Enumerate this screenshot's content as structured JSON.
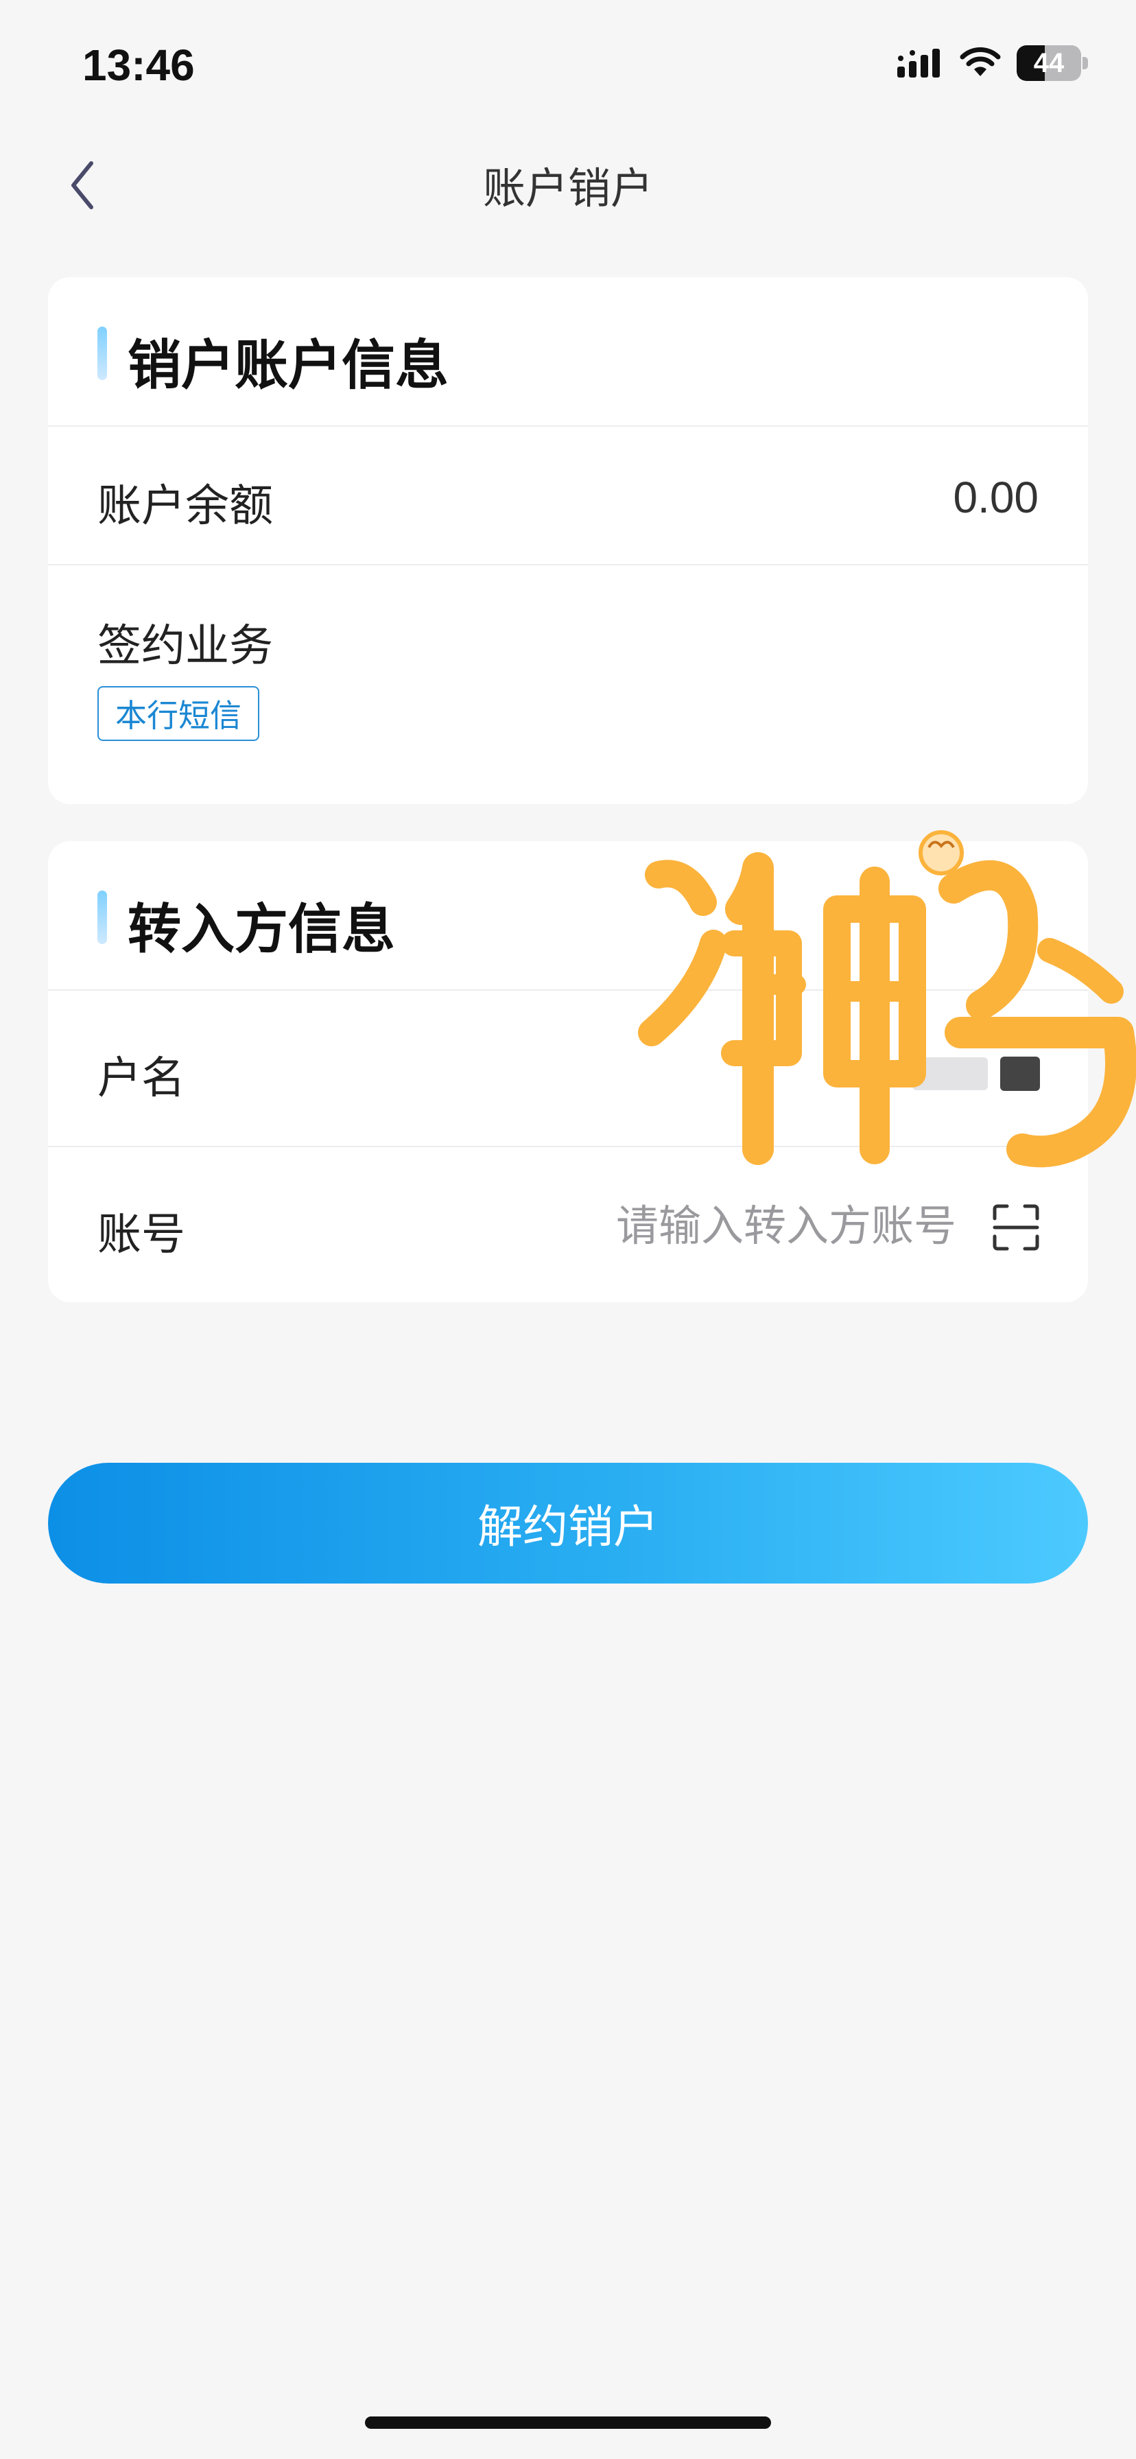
{
  "status_bar": {
    "time": "13:46",
    "battery_level": "44",
    "icons": [
      "signal-icon",
      "wifi-icon",
      "battery-icon"
    ]
  },
  "nav": {
    "title": "账户销户",
    "back_icon": "chevron-left-icon"
  },
  "account_info": {
    "section_title": "销户账户信息",
    "balance_label": "账户余额",
    "balance_value": "0.00",
    "services_label": "签约业务",
    "service_tag": "本行短信"
  },
  "payee_info": {
    "section_title": "转入方信息",
    "name_label": "户名",
    "account_label": "账号",
    "account_placeholder": "请输入转入方账号",
    "account_value": "",
    "scan_icon": "scan-icon"
  },
  "watermark": {
    "text": "冲鸭"
  },
  "actions": {
    "submit_label": "解约销户"
  },
  "colors": {
    "accent": "#1b87d3",
    "button_start": "#0c8fe6",
    "button_end": "#4ccaff",
    "background": "#f6f6f7",
    "watermark": "#fbb33c"
  }
}
